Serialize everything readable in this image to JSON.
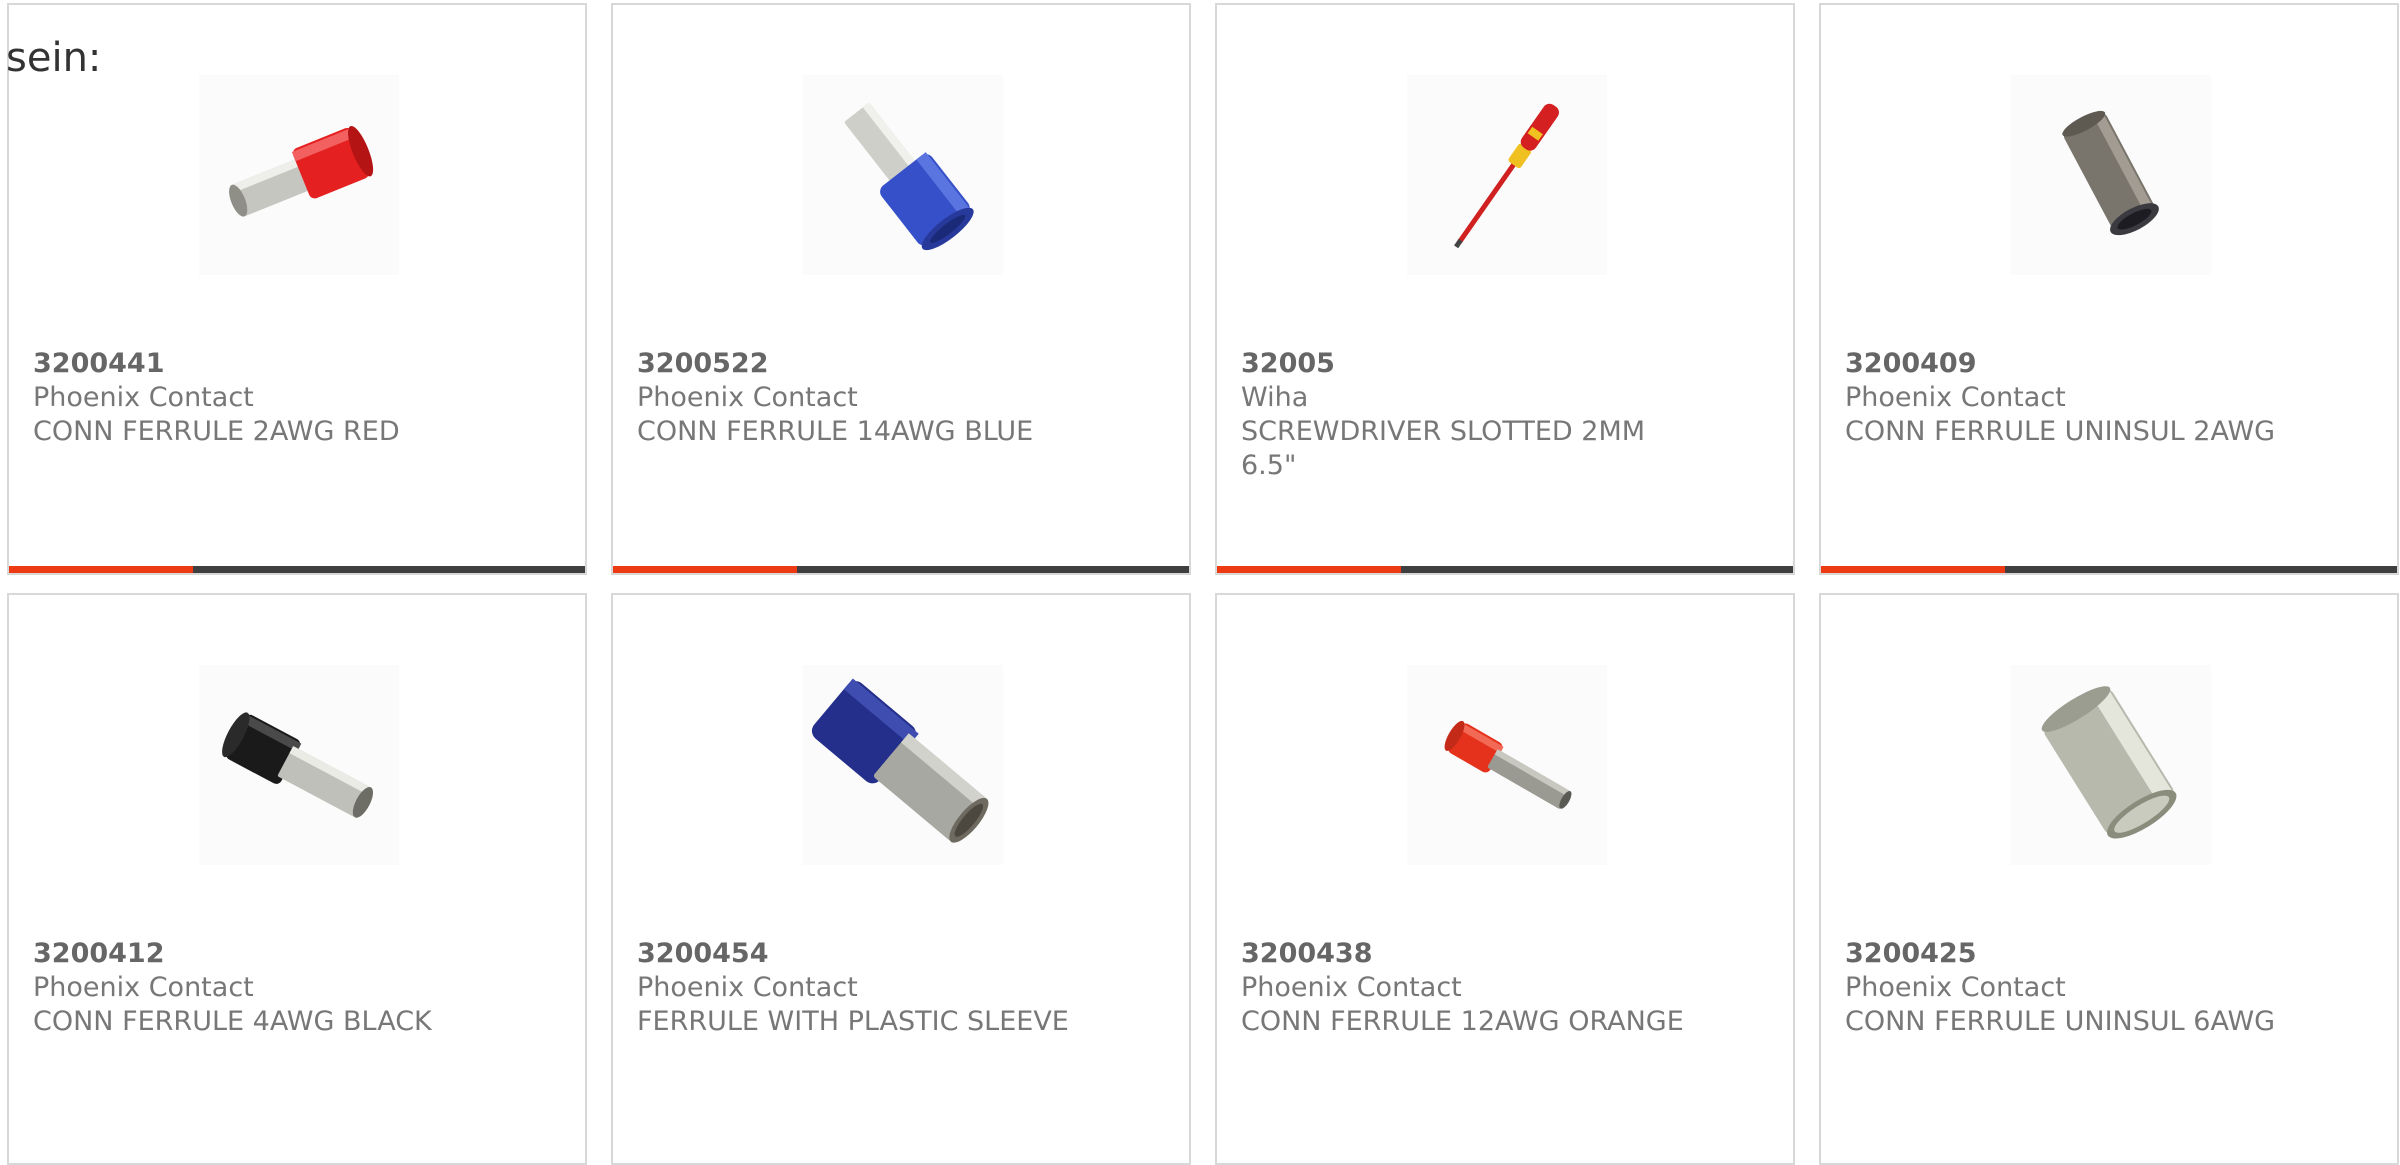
{
  "intro_text": "sein:",
  "accent_color": "#ee3a12",
  "bar_track_color": "#3f3f3f",
  "products": [
    {
      "part": "3200441",
      "manufacturer": "Phoenix Contact",
      "description": "CONN FERRULE 2AWG RED",
      "image_icon": "red-ferrule-image",
      "insulation_color": "#e52020",
      "progress": 0.32,
      "bar_visible": true
    },
    {
      "part": "3200522",
      "manufacturer": "Phoenix Contact",
      "description": "CONN FERRULE 14AWG BLUE",
      "image_icon": "blue-ferrule-image",
      "insulation_color": "#3550c8",
      "progress": 0.32,
      "bar_visible": true
    },
    {
      "part": "32005",
      "manufacturer": "Wiha",
      "description": "SCREWDRIVER SLOTTED 2MM 6.5\"",
      "image_icon": "screwdriver-image",
      "insulation_color": "#d42020",
      "progress": 0.32,
      "bar_visible": true
    },
    {
      "part": "3200409",
      "manufacturer": "Phoenix Contact",
      "description": "CONN FERRULE UNINSUL 2AWG",
      "image_icon": "uninsulated-ferrule-image",
      "insulation_color": "#7a756c",
      "progress": 0.32,
      "bar_visible": true
    },
    {
      "part": "3200412",
      "manufacturer": "Phoenix Contact",
      "description": "CONN FERRULE 4AWG BLACK",
      "image_icon": "black-ferrule-image",
      "insulation_color": "#1a1a1a",
      "progress": 0.32,
      "bar_visible": false
    },
    {
      "part": "3200454",
      "manufacturer": "Phoenix Contact",
      "description": "FERRULE WITH PLASTIC SLEEVE",
      "image_icon": "navy-ferrule-image",
      "insulation_color": "#232f8a",
      "progress": 0.32,
      "bar_visible": false
    },
    {
      "part": "3200438",
      "manufacturer": "Phoenix Contact",
      "description": "CONN FERRULE 12AWG ORANGE",
      "image_icon": "orange-ferrule-image",
      "insulation_color": "#e5321c",
      "progress": 0.32,
      "bar_visible": false
    },
    {
      "part": "3200425",
      "manufacturer": "Phoenix Contact",
      "description": "CONN FERRULE UNINSUL 6AWG",
      "image_icon": "uninsulated-ferrule-image",
      "insulation_color": "#b7b9ad",
      "progress": 0.32,
      "bar_visible": false
    }
  ]
}
